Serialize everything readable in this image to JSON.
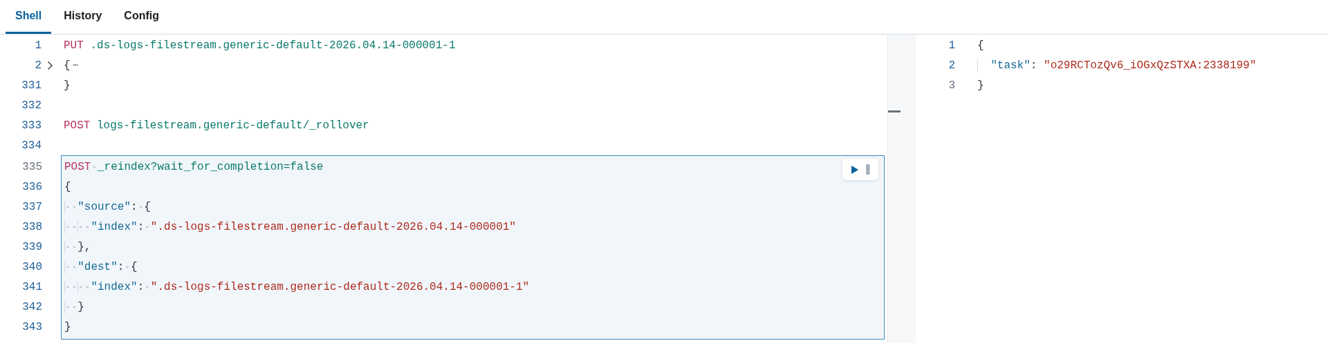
{
  "tabs": [
    {
      "label": "Shell",
      "selected": true
    },
    {
      "label": "History",
      "selected": false
    },
    {
      "label": "Config",
      "selected": false
    }
  ],
  "request_editor": {
    "lines": [
      {
        "number": "1",
        "dim": false,
        "tokens": [
          {
            "kind": "method",
            "text": "PUT"
          },
          {
            "kind": "url",
            "text": " .ds-logs-filestream.generic-default-2026.04.14-000001-1"
          }
        ]
      },
      {
        "number": "2",
        "dim": false,
        "folded": true,
        "tokens": [
          {
            "kind": "punct",
            "text": "{"
          },
          {
            "kind": "ellipsis",
            "text": "⋯"
          }
        ]
      },
      {
        "number": "331",
        "dim": false,
        "tokens": [
          {
            "kind": "punct",
            "text": "}"
          }
        ]
      },
      {
        "number": "332",
        "dim": false
      },
      {
        "number": "333",
        "dim": false,
        "tokens": [
          {
            "kind": "method",
            "text": "POST"
          },
          {
            "kind": "url",
            "text": " logs-filestream.generic-default/_rollover"
          }
        ]
      },
      {
        "number": "334",
        "dim": false
      }
    ],
    "selected_request": {
      "show_whitespace": true,
      "lines": [
        {
          "number": "335",
          "dim": true,
          "tokens": [
            {
              "kind": "method",
              "text": "POST"
            },
            {
              "kind": "url",
              "text": " _reindex?wait_for_completion=false"
            }
          ]
        },
        {
          "number": "336",
          "dim": false,
          "tokens": [
            {
              "kind": "punct",
              "text": "{"
            }
          ]
        },
        {
          "number": "337",
          "dim": false,
          "tokens": [
            {
              "kind": "key",
              "text": "  \"source\""
            },
            {
              "kind": "punct",
              "text": ": {"
            }
          ]
        },
        {
          "number": "338",
          "dim": false,
          "tokens": [
            {
              "kind": "key",
              "text": "    \"index\""
            },
            {
              "kind": "punct",
              "text": ": "
            },
            {
              "kind": "string",
              "text": "\".ds-logs-filestream.generic-default-2026.04.14-000001\""
            }
          ]
        },
        {
          "number": "339",
          "dim": false,
          "tokens": [
            {
              "kind": "punct",
              "text": "  },"
            }
          ]
        },
        {
          "number": "340",
          "dim": false,
          "tokens": [
            {
              "kind": "key",
              "text": "  \"dest\""
            },
            {
              "kind": "punct",
              "text": ": {"
            }
          ]
        },
        {
          "number": "341",
          "dim": false,
          "tokens": [
            {
              "kind": "key",
              "text": "    \"index\""
            },
            {
              "kind": "punct",
              "text": ": "
            },
            {
              "kind": "string",
              "text": "\".ds-logs-filestream.generic-default-2026.04.14-000001-1\""
            }
          ]
        },
        {
          "number": "342",
          "dim": false,
          "tokens": [
            {
              "kind": "punct",
              "text": "  }"
            }
          ]
        },
        {
          "number": "343",
          "dim": false,
          "tokens": [
            {
              "kind": "punct",
              "text": "}"
            }
          ]
        }
      ]
    }
  },
  "response": {
    "lines": [
      {
        "number": "1",
        "dim": false,
        "tokens": [
          {
            "kind": "punct",
            "text": "{"
          }
        ]
      },
      {
        "number": "2",
        "dim": false,
        "tokens": [
          {
            "kind": "key",
            "text": "  \"task\""
          },
          {
            "kind": "punct",
            "text": ": "
          },
          {
            "kind": "string",
            "text": "\"o29RCTozQv6_iOGxQzSTXA:2338199\""
          }
        ]
      },
      {
        "number": "3",
        "dim": true,
        "tokens": [
          {
            "kind": "punct",
            "text": "}"
          }
        ]
      }
    ]
  }
}
